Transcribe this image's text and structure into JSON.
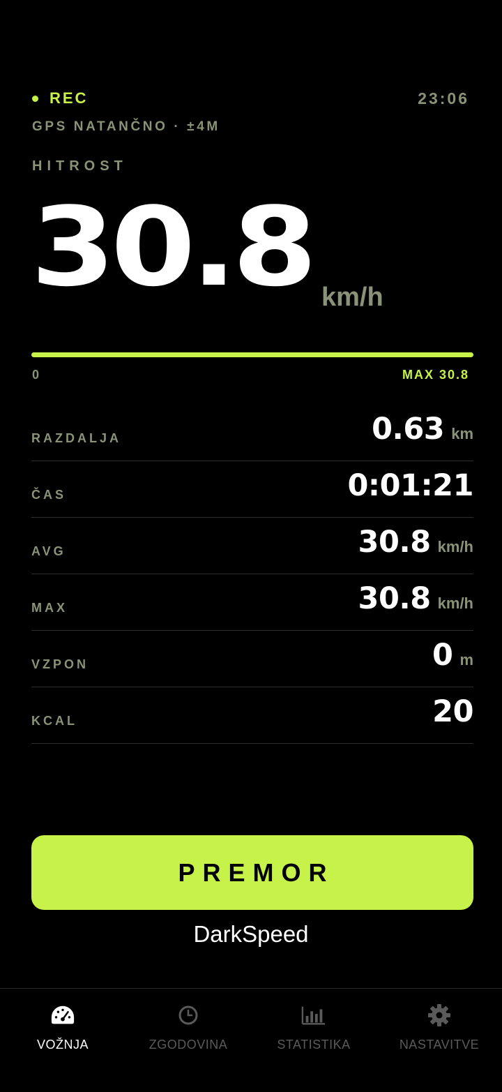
{
  "status": {
    "rec_label": "REC",
    "time": "23:06",
    "gps": "GPS NATANČNO · ±4M"
  },
  "speed": {
    "label": "HITROST",
    "value": "30.8",
    "unit": "km/h",
    "progress_fraction": 1.0,
    "bar_min": "0",
    "bar_max_label": "MAX 30.8"
  },
  "stats": [
    {
      "label": "RAZDALJA",
      "value": "0.63",
      "unit": "km"
    },
    {
      "label": "ČAS",
      "value": "0:01:21",
      "unit": ""
    },
    {
      "label": "AVG",
      "value": "30.8",
      "unit": "km/h"
    },
    {
      "label": "MAX",
      "value": "30.8",
      "unit": "km/h"
    },
    {
      "label": "VZPON",
      "value": "0",
      "unit": "m"
    },
    {
      "label": "KCAL",
      "value": "20",
      "unit": ""
    }
  ],
  "action": {
    "pause_label": "PREMOR"
  },
  "brand": "DarkSpeed",
  "nav": [
    {
      "label": "VOŽNJA",
      "icon": "speedometer-icon",
      "active": true
    },
    {
      "label": "ZGODOVINA",
      "icon": "clock-icon",
      "active": false
    },
    {
      "label": "STATISTIKA",
      "icon": "bar-chart-icon",
      "active": false
    },
    {
      "label": "NASTAVITVE",
      "icon": "gear-icon",
      "active": false
    }
  ],
  "colors": {
    "accent": "#c6f24a",
    "muted": "#8a9278",
    "background": "#000000"
  }
}
